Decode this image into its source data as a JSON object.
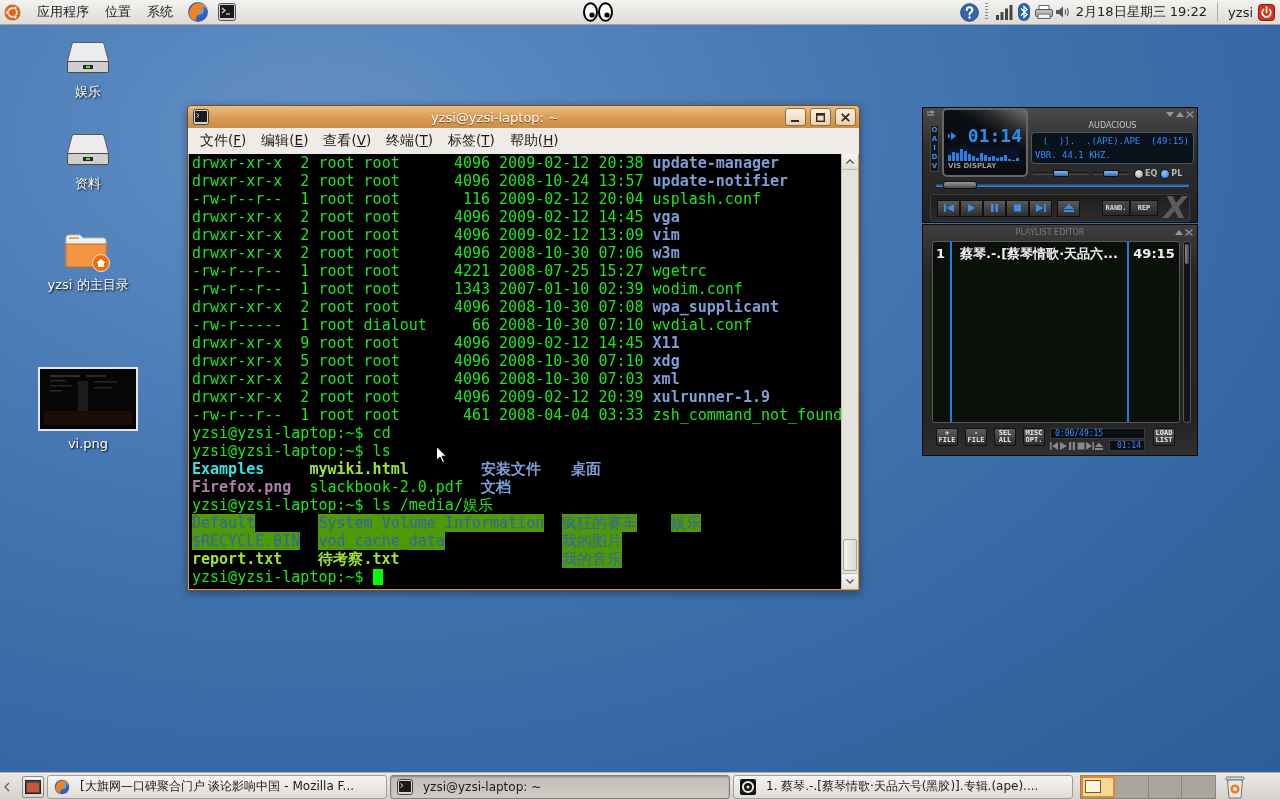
{
  "top_panel": {
    "menus": [
      {
        "label": "应用程序"
      },
      {
        "label": "位置"
      },
      {
        "label": "系统"
      }
    ],
    "clock": "2月18日星期三 19:22",
    "user": "yzsi"
  },
  "desktop_icons": [
    {
      "kind": "drive",
      "label": "娱乐"
    },
    {
      "kind": "drive",
      "label": "资料"
    },
    {
      "kind": "home",
      "label": "yzsi 的主目录"
    },
    {
      "kind": "image",
      "label": "vi.png"
    }
  ],
  "terminal": {
    "title": "yzsi@yzsi-laptop: ~",
    "menu": [
      {
        "label": "文件(F)"
      },
      {
        "label": "编辑(E)"
      },
      {
        "label": "查看(V)"
      },
      {
        "label": "终端(T)"
      },
      {
        "label": "标签(T)"
      },
      {
        "label": "帮助(H)"
      }
    ],
    "lines": [
      {
        "kind": "listing",
        "info": "drwxr-xr-x  2 root root      4096 2009-02-12 20:38",
        "file": {
          "name": "update-manager",
          "kind": "dir"
        }
      },
      {
        "kind": "listing",
        "info": "drwxr-xr-x  2 root root      4096 2008-10-24 13:57",
        "file": {
          "name": "update-notifier",
          "kind": "dir"
        }
      },
      {
        "kind": "listing",
        "info": "-rw-r--r--  1 root root       116 2009-02-12 20:04",
        "file": {
          "name": "usplash.conf",
          "kind": "file"
        }
      },
      {
        "kind": "listing",
        "info": "drwxr-xr-x  2 root root      4096 2009-02-12 14:45",
        "file": {
          "name": "vga",
          "kind": "dir"
        }
      },
      {
        "kind": "listing",
        "info": "drwxr-xr-x  2 root root      4096 2009-02-12 13:09",
        "file": {
          "name": "vim",
          "kind": "dir"
        }
      },
      {
        "kind": "listing",
        "info": "drwxr-xr-x  2 root root      4096 2008-10-30 07:06",
        "file": {
          "name": "w3m",
          "kind": "dir"
        }
      },
      {
        "kind": "listing",
        "info": "-rw-r--r--  1 root root      4221 2008-07-25 15:27",
        "file": {
          "name": "wgetrc",
          "kind": "file"
        }
      },
      {
        "kind": "listing",
        "info": "-rw-r--r--  1 root root      1343 2007-01-10 02:39",
        "file": {
          "name": "wodim.conf",
          "kind": "file"
        }
      },
      {
        "kind": "listing",
        "info": "drwxr-xr-x  2 root root      4096 2008-10-30 07:08",
        "file": {
          "name": "wpa_supplicant",
          "kind": "dir"
        }
      },
      {
        "kind": "listing",
        "info": "-rw-r-----  1 root dialout     66 2008-10-30 07:10",
        "file": {
          "name": "wvdial.conf",
          "kind": "file"
        }
      },
      {
        "kind": "listing",
        "info": "drwxr-xr-x  9 root root      4096 2009-02-12 14:45",
        "file": {
          "name": "X11",
          "kind": "dir"
        }
      },
      {
        "kind": "listing",
        "info": "drwxr-xr-x  5 root root      4096 2008-10-30 07:10",
        "file": {
          "name": "xdg",
          "kind": "dir"
        }
      },
      {
        "kind": "listing",
        "info": "drwxr-xr-x  2 root root      4096 2008-10-30 07:03",
        "file": {
          "name": "xml",
          "kind": "dir"
        }
      },
      {
        "kind": "listing",
        "info": "drwxr-xr-x  2 root root      4096 2009-02-12 20:39",
        "file": {
          "name": "xulrunner-1.9",
          "kind": "dir"
        }
      },
      {
        "kind": "listing",
        "info": "-rw-r--r--  1 root root       461 2008-04-04 03:33",
        "file": {
          "name": "zsh_command_not_found",
          "kind": "file"
        }
      },
      {
        "kind": "command",
        "text": "yzsi@yzsi-laptop:~$ cd"
      },
      {
        "kind": "command",
        "text": "yzsi@yzsi-laptop:~$ ls"
      },
      {
        "kind": "columns",
        "rows": [
          [
            {
              "name": "Examples",
              "kind": "link"
            },
            {
              "name": "mywiki.html",
              "kind": "exec"
            },
            {
              "name": "安装文件",
              "kind": "dir"
            },
            {
              "name": "桌面",
              "kind": "dir"
            }
          ],
          [
            {
              "name": "Firefox.png",
              "kind": "image"
            },
            {
              "name": "slackbook-2.0.pdf",
              "kind": "file"
            },
            {
              "name": "文档",
              "kind": "dir"
            }
          ]
        ]
      },
      {
        "kind": "command",
        "text": "yzsi@yzsi-laptop:~$ ls /media/娱乐"
      },
      {
        "kind": "columns",
        "rows": [
          [
            {
              "name": "Default",
              "kind": "shared_dir"
            },
            {
              "name": "System Volume Information",
              "kind": "shared_dir"
            },
            {
              "name": "疯狂的赛车",
              "kind": "shared_dir"
            },
            {
              "name": "娱乐",
              "kind": "shared_dir"
            }
          ],
          [
            {
              "name": "$RECYCLE.BIN",
              "kind": "shared_dir"
            },
            {
              "name": "vod_cache_data",
              "kind": "shared_dir"
            },
            {
              "name": "我的图片",
              "kind": "shared_dir"
            }
          ],
          [
            {
              "name": "report.txt",
              "kind": "exec"
            },
            {
              "name": "待考察.txt",
              "kind": "exec"
            },
            {
              "name": "我的音乐",
              "kind": "shared_dir"
            }
          ]
        ]
      },
      {
        "kind": "prompt",
        "text": "yzsi@yzsi-laptop:~$"
      }
    ]
  },
  "player": {
    "clutterbar": "OAIDV",
    "time": "01:14",
    "vis_label": "VIS DISPLAY",
    "title": "AUDACIOUS",
    "info": [
      "(  )].  .(APE).APE  (49:15)",
      "VBR. 44.1 KHZ."
    ],
    "volume": {
      "level": 0.5
    },
    "balance": {
      "level": 0.5
    },
    "toggles": [
      {
        "label": "EQ",
        "on": false
      },
      {
        "label": "PL",
        "on": true
      }
    ],
    "seek": {
      "level": 0.03
    },
    "buttons": [
      {
        "label": "RAND."
      },
      {
        "label": "REP"
      }
    ],
    "logo": "X"
  },
  "playlist": {
    "title": "PLAYLIST EDITOR",
    "entries": [
      {
        "number": "1",
        "title": "蔡琴.-.[蔡琴情歌·天品六...",
        "length": "49:15"
      }
    ],
    "buttons": [
      {
        "label": "+ FILE"
      },
      {
        "label": "- FILE"
      },
      {
        "label": "SEL ALL"
      },
      {
        "label": "MISC OPT."
      }
    ],
    "time": "0:00/49:15",
    "mini_time": "01:14",
    "load_button": "LOAD LIST"
  },
  "taskbar": {
    "tasks": [
      {
        "kind": "browser",
        "label": "[大旗网—口碑聚合门户 谈论影响中国 - Mozilla F...",
        "selected": false
      },
      {
        "kind": "terminal",
        "label": "yzsi@yzsi-laptop: ~",
        "selected": true
      },
      {
        "kind": "player",
        "label": "1. 蔡琴.-.[蔡琴情歌·天品六号(黑胶)].专辑.(ape)....",
        "selected": false
      }
    ],
    "workspaces": [
      {
        "selected": true
      },
      {
        "selected": false
      },
      {
        "selected": false
      },
      {
        "selected": false
      }
    ]
  }
}
